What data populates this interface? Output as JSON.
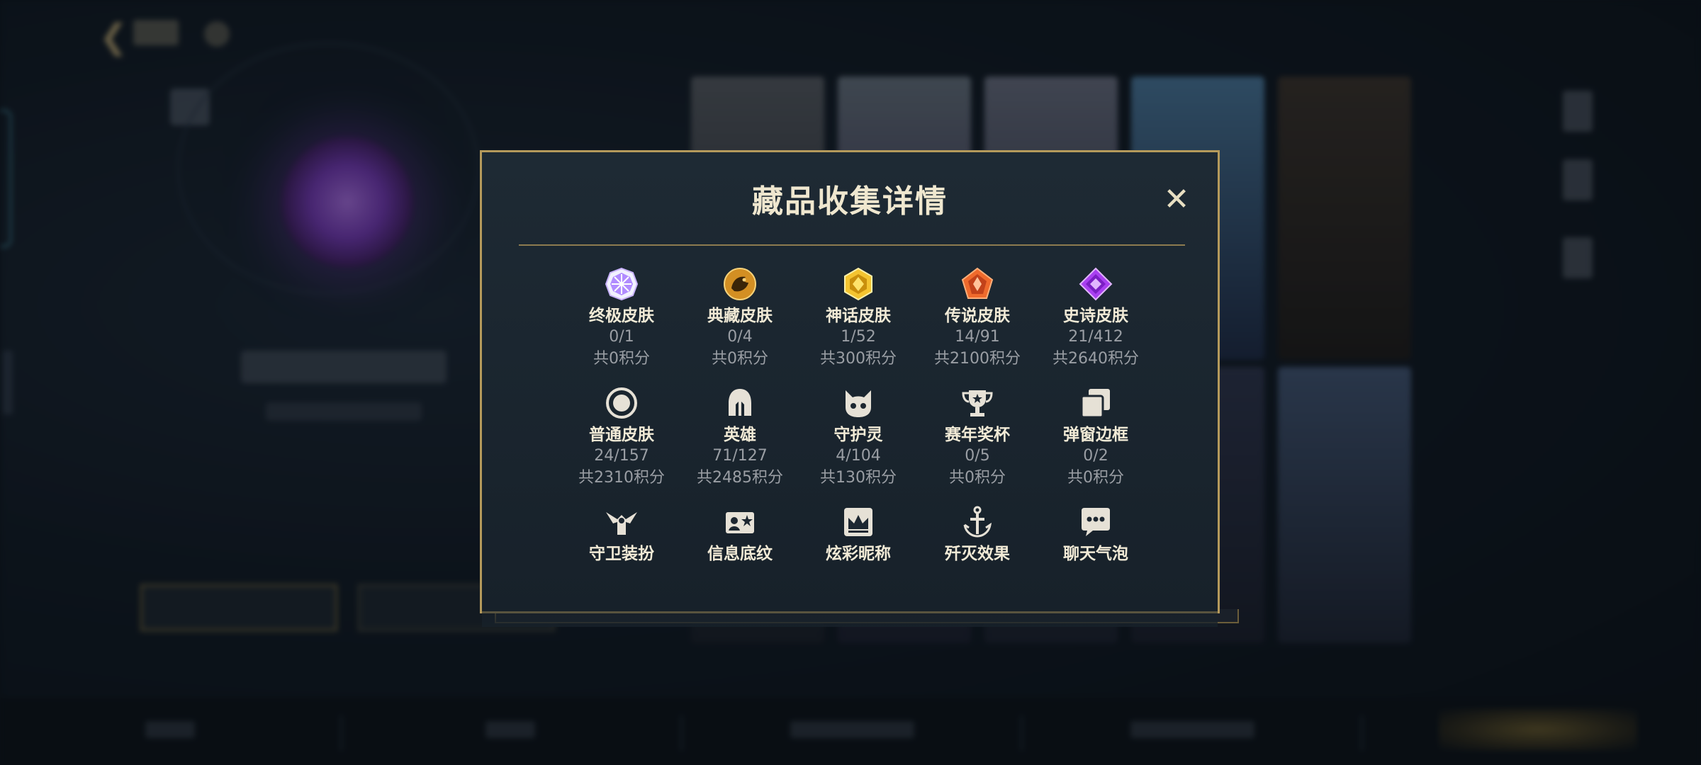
{
  "modal": {
    "title": "藏品收集详情",
    "close_label": "✕",
    "rows": [
      [
        {
          "icon": "ultimate-skin-icon",
          "label": "终极皮肤",
          "count": "0/1",
          "points": "共0积分",
          "color": "#c9b3ff"
        },
        {
          "icon": "treasure-skin-icon",
          "label": "典藏皮肤",
          "count": "0/4",
          "points": "共0积分",
          "color": "#e2a53a"
        },
        {
          "icon": "mythic-skin-icon",
          "label": "神话皮肤",
          "count": "1/52",
          "points": "共300积分",
          "color": "#f1c232"
        },
        {
          "icon": "legendary-skin-icon",
          "label": "传说皮肤",
          "count": "14/91",
          "points": "共2100积分",
          "color": "#ef6a2c"
        },
        {
          "icon": "epic-skin-icon",
          "label": "史诗皮肤",
          "count": "21/412",
          "points": "共2640积分",
          "color": "#a93ff0"
        }
      ],
      [
        {
          "icon": "normal-skin-icon",
          "label": "普通皮肤",
          "count": "24/157",
          "points": "共2310积分",
          "color": "#e6e1d6"
        },
        {
          "icon": "hero-helmet-icon",
          "label": "英雄",
          "count": "71/127",
          "points": "共2485积分",
          "color": "#e6e1d6"
        },
        {
          "icon": "guardian-pet-icon",
          "label": "守护灵",
          "count": "4/104",
          "points": "共130积分",
          "color": "#e6e1d6"
        },
        {
          "icon": "trophy-icon",
          "label": "赛年奖杯",
          "count": "0/5",
          "points": "共0积分",
          "color": "#e6e1d6"
        },
        {
          "icon": "popup-frame-icon",
          "label": "弹窗边框",
          "count": "0/2",
          "points": "共0积分",
          "color": "#e6e1d6"
        }
      ],
      [
        {
          "icon": "guard-outfit-icon",
          "label": "守卫装扮",
          "count": "",
          "points": "",
          "color": "#e6e1d6"
        },
        {
          "icon": "info-card-icon",
          "label": "信息底纹",
          "count": "",
          "points": "",
          "color": "#e6e1d6"
        },
        {
          "icon": "crown-nameplate-icon",
          "label": "炫彩昵称",
          "count": "",
          "points": "",
          "color": "#e6e1d6"
        },
        {
          "icon": "anchor-effect-icon",
          "label": "歼灭效果",
          "count": "",
          "points": "",
          "color": "#e6e1d6"
        },
        {
          "icon": "chat-bubble-icon",
          "label": "聊天气泡",
          "count": "",
          "points": "",
          "color": "#e6e1d6"
        }
      ]
    ]
  },
  "colors": {
    "accent_gold": "#b59a5b",
    "panel_bg": "#1b2630"
  }
}
